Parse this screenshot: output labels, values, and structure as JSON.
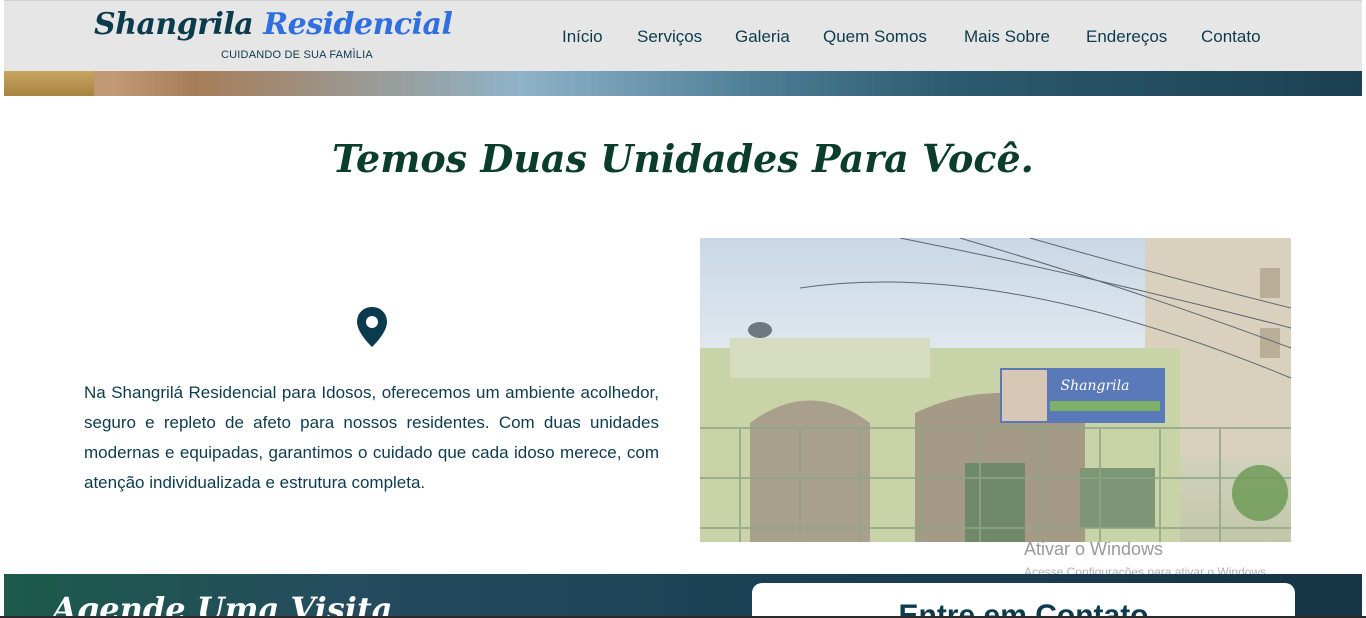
{
  "header": {
    "brand": {
      "name_part1": "Shangrila",
      "name_part2": "Residencial",
      "tagline": "CUIDANDO DE SUA FAMÌLIA"
    },
    "nav": [
      {
        "label": "Início"
      },
      {
        "label": "Serviços"
      },
      {
        "label": "Galeria"
      },
      {
        "label": "Quem Somos"
      },
      {
        "label": "Mais Sobre"
      },
      {
        "label": "Endereços"
      },
      {
        "label": "Contato"
      }
    ]
  },
  "units_section": {
    "title": "Temos Duas Unidades Para Você.",
    "icon": "map-pin-icon",
    "text": "Na Shangrilá Residencial para Idosos, oferecemos um ambiente acolhedor, seguro e repleto de afeto para nossos residentes. Com duas unidades modernas e equipadas, garantimos o cuidado que cada idoso merece, com atenção individualizada e estrutura completa.",
    "photo_sign": "Shangrila"
  },
  "bottom_section": {
    "visit_title": "Agende Uma Visita",
    "contact_title": "Entre em Contato"
  },
  "watermark": {
    "title": "Ativar o Windows",
    "subtitle": "Acesse Configurações para ativar o Windows."
  },
  "colors": {
    "brand_dark": "#0d3b4e",
    "brand_accent": "#2f6fe0",
    "title_green": "#0b3d2c",
    "nav_bg": "#e6e6e6"
  }
}
